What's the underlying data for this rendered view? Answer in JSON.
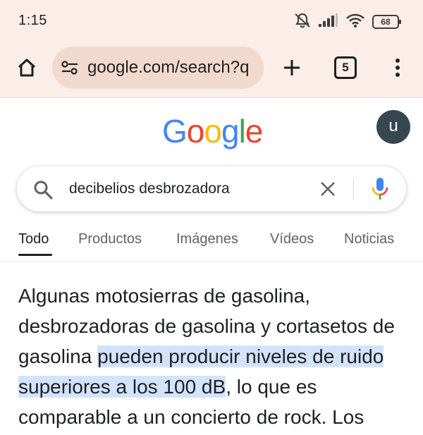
{
  "status_bar": {
    "time": "1:15",
    "battery": "68",
    "icons": [
      "mute-icon",
      "signal-icon",
      "wifi-icon",
      "battery-icon"
    ]
  },
  "browser": {
    "url": "google.com/search?q",
    "tab_count": "5",
    "icons": [
      "home-icon",
      "site-settings-icon",
      "plus-icon",
      "more-vert-icon"
    ]
  },
  "header": {
    "logo_letters": [
      "G",
      "o",
      "o",
      "g",
      "l",
      "e"
    ],
    "logo_colors": [
      "#4285F4",
      "#EA4335",
      "#FBBC05",
      "#4285F4",
      "#34A853",
      "#EA4335"
    ],
    "avatar_letter": "u"
  },
  "search": {
    "query": "decibelios desbrozadora"
  },
  "tabs": [
    {
      "label": "Todo",
      "active": true
    },
    {
      "label": "Productos",
      "active": false
    },
    {
      "label": "Imágenes",
      "active": false
    },
    {
      "label": "Vídeos",
      "active": false
    },
    {
      "label": "Noticias",
      "active": false
    }
  ],
  "result": {
    "before": "Algunas motosierras de gasolina, desbrozadoras de gasolina y cortasetos de gasolina ",
    "highlight": "pueden producir niveles de ruido superiores a los 100 dB",
    "after": ", lo que es comparable a un concierto de rock. Los"
  },
  "colors": {
    "chrome_bg": "#fbeee9",
    "url_pill_bg": "#f2d9ce",
    "highlight_bg": "#d3e3fd",
    "avatar_bg": "#37474f"
  }
}
